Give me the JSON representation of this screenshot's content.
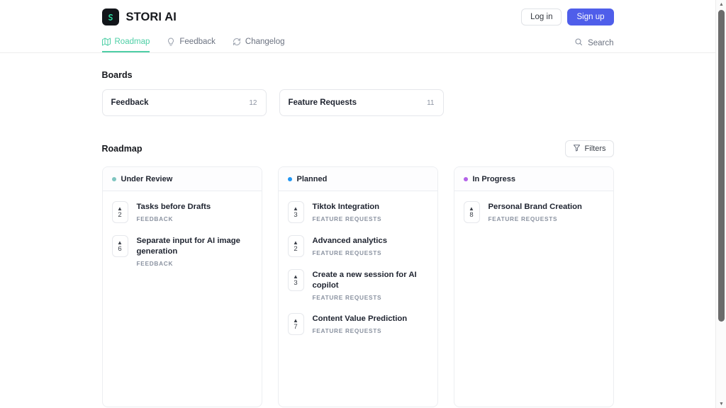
{
  "header": {
    "brand_name": "STORI AI",
    "logo_icon": "stori-s-logo",
    "login_label": "Log in",
    "signup_label": "Sign up",
    "signup_color": "#4f5eea",
    "accent_color": "#4ecfa6",
    "tabs": [
      {
        "label": "Roadmap",
        "icon": "map-icon",
        "active": true
      },
      {
        "label": "Feedback",
        "icon": "lightbulb-icon",
        "active": false
      },
      {
        "label": "Changelog",
        "icon": "refresh-icon",
        "active": false
      }
    ],
    "search": {
      "label": "Search",
      "icon": "search-icon"
    }
  },
  "boards": {
    "title": "Boards",
    "items": [
      {
        "name": "Feedback",
        "count": "12"
      },
      {
        "name": "Feature Requests",
        "count": "11"
      }
    ]
  },
  "roadmap": {
    "title": "Roadmap",
    "filters": {
      "label": "Filters",
      "icon": "funnel-icon"
    },
    "columns": [
      {
        "title": "Under Review",
        "dot_color": "#7fc5c0",
        "items": [
          {
            "votes": "2",
            "title": "Tasks before Drafts",
            "board": "FEEDBACK"
          },
          {
            "votes": "6",
            "title": "Separate input for AI image generation",
            "board": "FEEDBACK"
          }
        ]
      },
      {
        "title": "Planned",
        "dot_color": "#2196f3",
        "items": [
          {
            "votes": "3",
            "title": "Tiktok Integration",
            "board": "FEATURE REQUESTS"
          },
          {
            "votes": "2",
            "title": "Advanced analytics",
            "board": "FEATURE REQUESTS"
          },
          {
            "votes": "3",
            "title": "Create a new session for AI copilot",
            "board": "FEATURE REQUESTS"
          },
          {
            "votes": "7",
            "title": "Content Value Prediction",
            "board": "FEATURE REQUESTS"
          }
        ]
      },
      {
        "title": "In Progress",
        "dot_color": "#b362e8",
        "items": [
          {
            "votes": "8",
            "title": "Personal Brand Creation",
            "board": "FEATURE REQUESTS"
          }
        ]
      }
    ]
  },
  "scrollbar": {
    "up_arrow": "▲",
    "down_arrow": "▼"
  }
}
